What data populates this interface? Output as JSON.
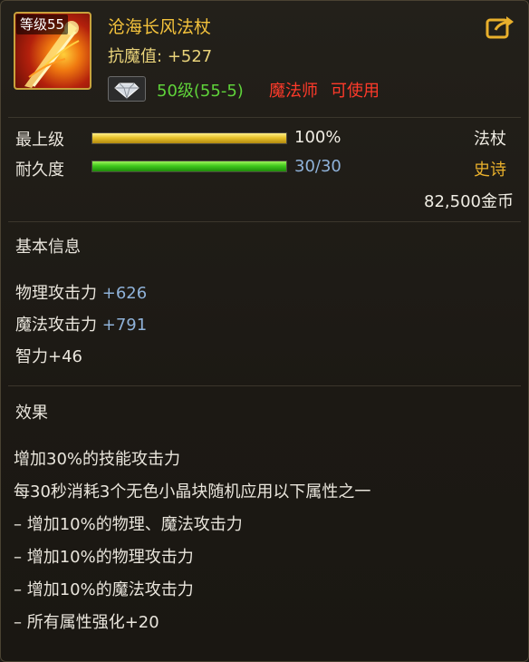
{
  "item": {
    "level_tag": "等级55",
    "name": "沧海长风法杖",
    "resist_label": "抗魔值:",
    "resist_value": "+527",
    "req_level": "50级(55-5)",
    "req_class": "魔法师",
    "req_usable": "可使用"
  },
  "stats": {
    "grade_label": "最上级",
    "grade_value": "100%",
    "grade_fill": 1.0,
    "durability_label": "耐久度",
    "durability_value": "30/30",
    "durability_fill": 1.0,
    "weapon_type": "法杖",
    "rarity": "史诗",
    "price": "82,500金币"
  },
  "basic": {
    "header": "基本信息",
    "phys_label": "物理攻击力",
    "phys_value": "+626",
    "magic_label": "魔法攻击力",
    "magic_value": "+791",
    "int_line": "智力+46"
  },
  "effect": {
    "header": "效果",
    "lines": [
      "增加30%的技能攻击力",
      "每30秒消耗3个无色小晶块随机应用以下属性之一",
      "– 增加10%的物理、魔法攻击力",
      "– 增加10%的物理攻击力",
      "– 增加10%的魔法攻击力",
      "– 所有属性强化+20"
    ]
  },
  "colors": {
    "title": "#f3c23c",
    "rarity_epic": "#e9b02c",
    "requirement_ok": "#5fd23a",
    "requirement_class": "#ff3a2a",
    "bonus_value": "#8fb2d9"
  },
  "icons": {
    "item_icon": "staff-icon",
    "gem_icon": "diamond-icon",
    "share_icon": "share-icon"
  }
}
